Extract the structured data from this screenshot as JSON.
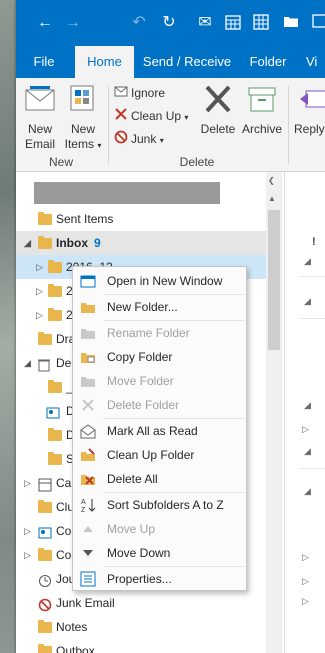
{
  "titlebar": {
    "icons": [
      "back-arrow-icon",
      "forward-arrow-icon",
      "undo-icon",
      "send-receive-icon",
      "envelope-icon",
      "calendar-icon",
      "grid-icon",
      "folder-icon",
      "square-icon"
    ]
  },
  "tabs": [
    {
      "label": "File",
      "active": false
    },
    {
      "label": "Home",
      "active": true
    },
    {
      "label": "Send / Receive",
      "active": false
    },
    {
      "label": "Folder",
      "active": false
    },
    {
      "label": "Vi",
      "active": false
    }
  ],
  "ribbon": {
    "new_email": "New\nEmail",
    "new_items": "New\nItems",
    "group_new": "New",
    "ignore": "Ignore",
    "clean_up": "Clean Up",
    "junk": "Junk",
    "delete": "Delete",
    "archive": "Archive",
    "reply": "Reply",
    "group_delete": "Delete"
  },
  "folders": [
    {
      "label": "Sent Items"
    },
    {
      "label": "Inbox",
      "count": "9"
    },
    {
      "label": "2016_12"
    },
    {
      "label": "2"
    },
    {
      "label": "2"
    },
    {
      "label": "Dra"
    },
    {
      "label": "Del"
    },
    {
      "label": "_"
    },
    {
      "label": "D"
    },
    {
      "label": "D"
    },
    {
      "label": "S"
    },
    {
      "label": "Cal"
    },
    {
      "label": "Clu"
    },
    {
      "label": "Co"
    },
    {
      "label": "Co"
    },
    {
      "label": "Jou"
    },
    {
      "label": "Junk Email"
    },
    {
      "label": "Notes"
    },
    {
      "label": "Outbox"
    }
  ],
  "context_menu": {
    "items": [
      {
        "label": "Open in New Window",
        "icon": "new-window-icon",
        "disabled": false
      },
      {
        "label": "New Folder...",
        "icon": "new-folder-icon",
        "disabled": false
      },
      {
        "label": "Rename Folder",
        "icon": "rename-folder-icon",
        "disabled": true
      },
      {
        "label": "Copy Folder",
        "icon": "copy-folder-icon",
        "disabled": false
      },
      {
        "label": "Move Folder",
        "icon": "move-folder-icon",
        "disabled": true
      },
      {
        "label": "Delete Folder",
        "icon": "delete-folder-icon",
        "disabled": true
      },
      {
        "label": "Mark All as Read",
        "icon": "mark-read-icon",
        "disabled": false
      },
      {
        "label": "Clean Up Folder",
        "icon": "clean-up-icon",
        "disabled": false
      },
      {
        "label": "Delete All",
        "icon": "delete-all-icon",
        "disabled": false
      },
      {
        "label": "Sort Subfolders A to Z",
        "icon": "sort-az-icon",
        "disabled": false
      },
      {
        "label": "Move Up",
        "icon": "move-up-icon",
        "disabled": true
      },
      {
        "label": "Move Down",
        "icon": "move-down-icon",
        "disabled": false
      },
      {
        "label": "Properties...",
        "icon": "properties-icon",
        "disabled": false
      }
    ]
  },
  "colors": {
    "accent": "#0072c6",
    "selected": "#cde6f7",
    "folder": "#e8b64c"
  }
}
